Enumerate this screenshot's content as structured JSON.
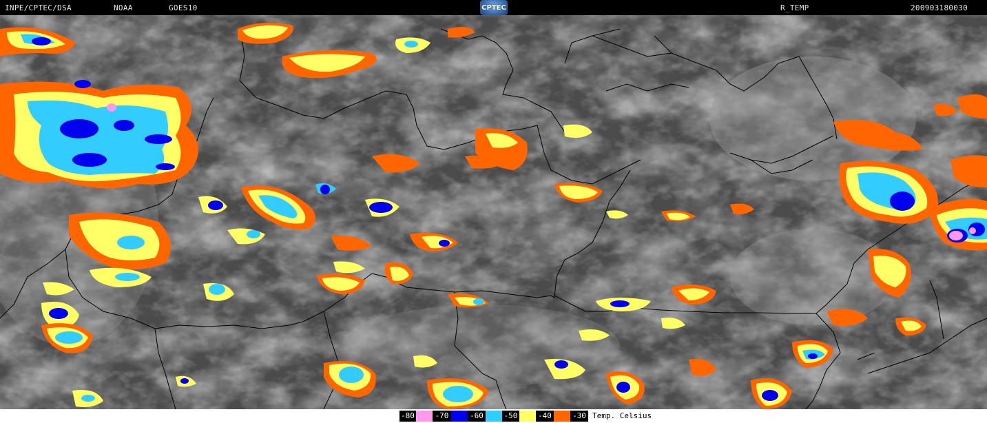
{
  "header": {
    "source": "INPE/CPTEC/DSA",
    "agency": "NOAA",
    "satellite": "GOES10",
    "logo_text": "CPTEC",
    "product": "R_TEMP",
    "timestamp": "200903180030"
  },
  "legend": {
    "unit_label": "Temp. Celsius",
    "items": [
      {
        "label": "-80",
        "color": "#ff99ee"
      },
      {
        "label": "-70",
        "color": "#0000ee"
      },
      {
        "label": "-60",
        "color": "#33ccff"
      },
      {
        "label": "-50",
        "color": "#ffff66"
      },
      {
        "label": "-40",
        "color": "#ff6600"
      },
      {
        "label": "-30",
        "color": ""
      }
    ]
  },
  "colors": {
    "t80": "#ff99ee",
    "t70": "#0000ee",
    "t60": "#33ccff",
    "t50": "#ffff66",
    "t40": "#ff6600",
    "background_gray": "#4a4a4a",
    "border_line": "#000000"
  }
}
